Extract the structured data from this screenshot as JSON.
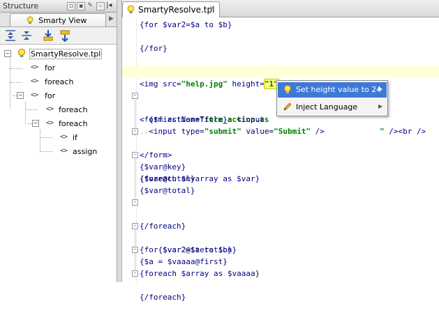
{
  "structure": {
    "title": "Structure",
    "tab_label": "Smarty View",
    "tree": [
      {
        "label": "SmartyResolve.tpl",
        "level": 0
      },
      {
        "label": "for",
        "level": 1
      },
      {
        "label": "foreach",
        "level": 1
      },
      {
        "label": "for",
        "level": 1
      },
      {
        "label": "foreach",
        "level": 2
      },
      {
        "label": "foreach",
        "level": 2
      },
      {
        "label": "if",
        "level": 3
      },
      {
        "label": "assign",
        "level": 3
      }
    ]
  },
  "editor": {
    "tab_label": "SmartyResolve.tpl",
    "lines": {
      "l1": "{for $var2=$a to $b}",
      "l2": "",
      "l3": "{/for}",
      "l4": "",
      "l5a": "<img src=",
      "l5b": "\"help.jpg\"",
      "l5c": " height=",
      "l5d": "\"1\"",
      "l5e": ">",
      "l6": "",
      "l7a": "<form action=",
      "l7b": "\"form_action.as",
      "l8a": "{$firstNameTitle}: <input",
      "l8b": "\"",
      "l8c": " /><br />",
      "l9a": "<input type=",
      "l9b": "\"submit\"",
      "l9c": " value=",
      "l9d": "\"Submit\"",
      "l9e": " />",
      "l10": "</form>",
      "l11": "",
      "l12": "{foreach $myarray as $var}",
      "l13": "{$var@key}",
      "l14": "{$var@total}",
      "l15": "{$var@total}",
      "l16": "{/foreach}",
      "l17": "",
      "l18": "{for $var2=$a to $b}",
      "l19": "{$var2@iteration}",
      "l20": "{foreach $array as $vaaaa}",
      "l21": "{$a = $vaaaa@first}",
      "l22": "{/foreach}"
    }
  },
  "popup": {
    "items": [
      {
        "label": "Set height value to 24",
        "selected": true,
        "icon": "bulb-icon"
      },
      {
        "label": "Inject Language",
        "selected": false,
        "icon": "pencil-icon"
      }
    ]
  },
  "colors": {
    "selection": "#3d7ad8",
    "current_line": "#ffffd8",
    "code_text": "#000080",
    "string": "#008000"
  }
}
